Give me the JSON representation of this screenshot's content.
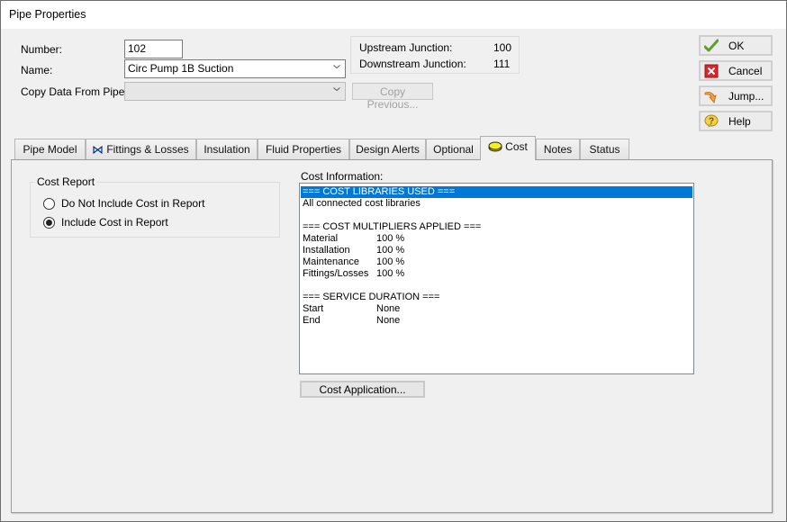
{
  "window": {
    "title": "Pipe Properties"
  },
  "form": {
    "number_label": "Number:",
    "number_value": "102",
    "name_label": "Name:",
    "name_value": "Circ Pump 1B Suction",
    "copy_label": "Copy Data From Pipe...",
    "copy_value": "",
    "copy_previous_button": "Copy Previous..."
  },
  "junctions": {
    "upstream_label": "Upstream Junction:",
    "upstream_value": "100",
    "downstream_label": "Downstream Junction:",
    "downstream_value": "111"
  },
  "side_buttons": {
    "ok": "OK",
    "cancel": "Cancel",
    "jump": "Jump...",
    "help": "Help"
  },
  "tabs": [
    {
      "label": "Pipe Model",
      "icon": null,
      "active": false
    },
    {
      "label": "Fittings & Losses",
      "icon": "bowtie-valve-icon",
      "active": false
    },
    {
      "label": "Insulation",
      "icon": null,
      "active": false
    },
    {
      "label": "Fluid Properties",
      "icon": null,
      "active": false
    },
    {
      "label": "Design Alerts",
      "icon": null,
      "active": false
    },
    {
      "label": "Optional",
      "icon": null,
      "active": false
    },
    {
      "label": "Cost",
      "icon": "coin-icon",
      "active": true
    },
    {
      "label": "Notes",
      "icon": null,
      "active": false
    },
    {
      "label": "Status",
      "icon": null,
      "active": false
    }
  ],
  "cost_report": {
    "legend": "Cost Report",
    "options": [
      {
        "label": "Do Not Include Cost in Report",
        "selected": false
      },
      {
        "label": "Include Cost in Report",
        "selected": true
      }
    ]
  },
  "cost_info": {
    "label": "Cost Information:",
    "lines": [
      {
        "text": "=== COST LIBRARIES USED ===",
        "value": "",
        "selected": true
      },
      {
        "text": "All connected cost libraries",
        "value": ""
      },
      {
        "text": "",
        "value": ""
      },
      {
        "text": "=== COST MULTIPLIERS APPLIED ===",
        "value": ""
      },
      {
        "text": "Material",
        "value": "100 %"
      },
      {
        "text": "Installation",
        "value": "100 %"
      },
      {
        "text": "Maintenance",
        "value": "100 %"
      },
      {
        "text": "Fittings/Losses",
        "value": "100 %"
      },
      {
        "text": "",
        "value": ""
      },
      {
        "text": "=== SERVICE DURATION ===",
        "value": ""
      },
      {
        "text": "Start",
        "value": "None"
      },
      {
        "text": "End",
        "value": "None"
      }
    ],
    "cost_application_button": "Cost Application..."
  },
  "colors": {
    "selection": "#0078d7",
    "ok_check": "#5aa02c",
    "cancel_red": "#d9262c"
  }
}
